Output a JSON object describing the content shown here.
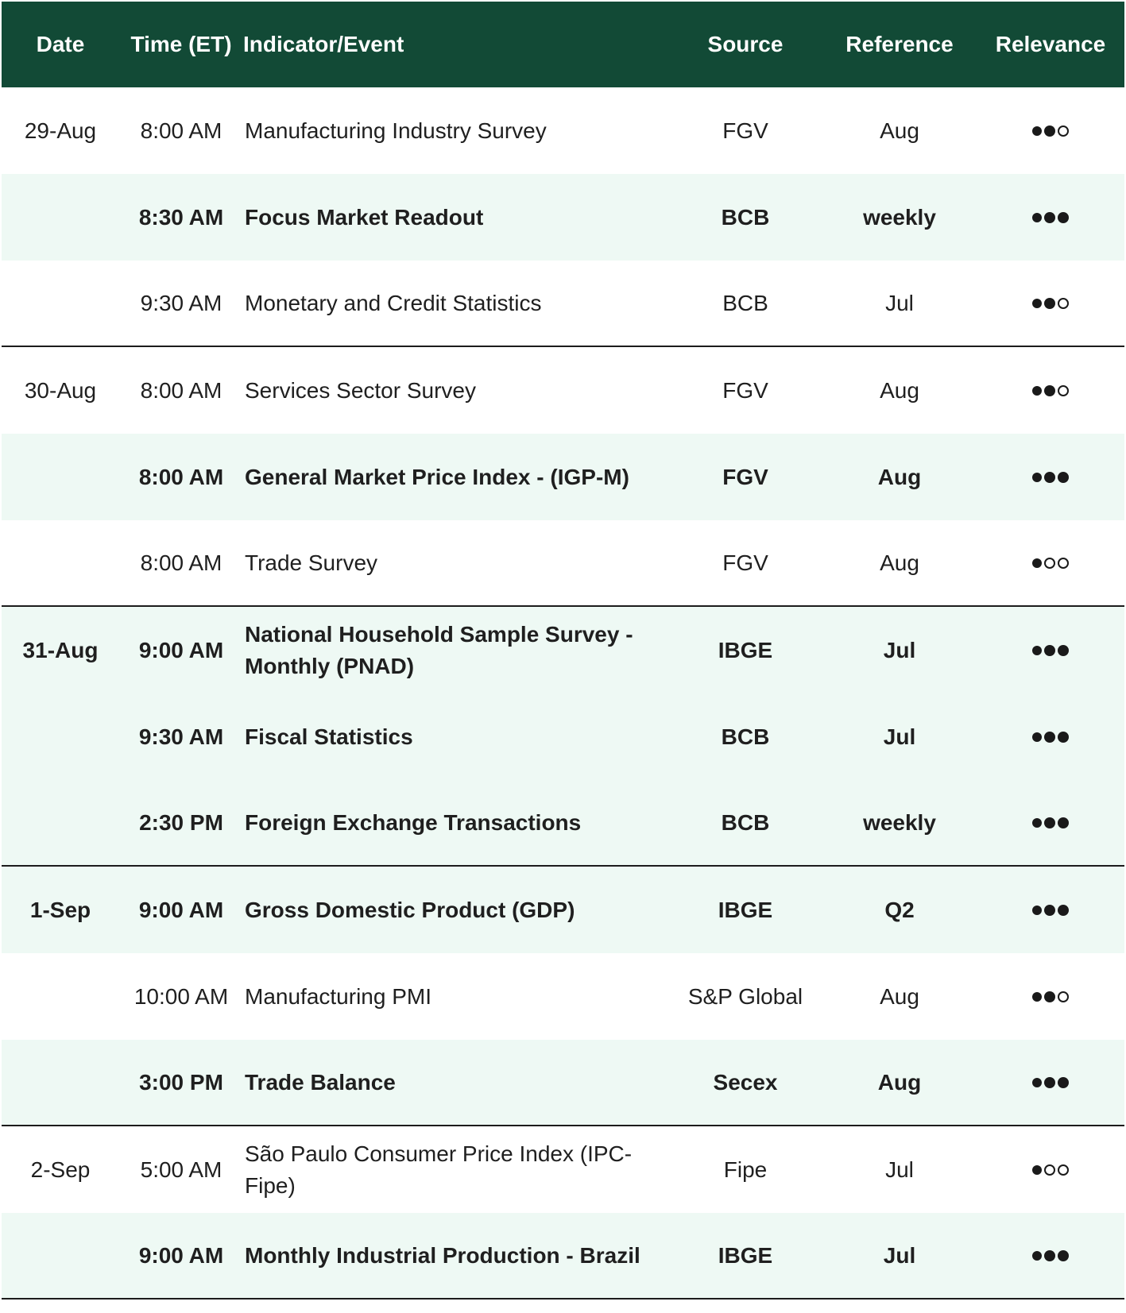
{
  "header": {
    "date": "Date",
    "time": "Time (ET)",
    "event": "Indicator/Event",
    "source": "Source",
    "reference": "Reference",
    "relevance": "Relevance"
  },
  "rows": [
    {
      "date": "29-Aug",
      "time": "8:00 AM",
      "event": "Manufacturing Industry Survey",
      "source": "FGV",
      "reference": "Aug",
      "relevance": 2,
      "bold": false,
      "shade": false,
      "sep": false
    },
    {
      "date": "",
      "time": "8:30 AM",
      "event": "Focus Market Readout",
      "source": "BCB",
      "reference": "weekly",
      "relevance": 3,
      "bold": true,
      "shade": true,
      "sep": false
    },
    {
      "date": "",
      "time": "9:30 AM",
      "event": "Monetary and Credit Statistics",
      "source": "BCB",
      "reference": "Jul",
      "relevance": 2,
      "bold": false,
      "shade": false,
      "sep": true
    },
    {
      "date": "30-Aug",
      "time": "8:00 AM",
      "event": "Services Sector Survey",
      "source": "FGV",
      "reference": "Aug",
      "relevance": 2,
      "bold": false,
      "shade": false,
      "sep": false
    },
    {
      "date": "",
      "time": "8:00 AM",
      "event": "General Market Price Index - (IGP-M)",
      "source": "FGV",
      "reference": "Aug",
      "relevance": 3,
      "bold": true,
      "shade": true,
      "sep": false
    },
    {
      "date": "",
      "time": "8:00 AM",
      "event": "Trade Survey",
      "source": "FGV",
      "reference": "Aug",
      "relevance": 1,
      "bold": false,
      "shade": false,
      "sep": true
    },
    {
      "date": "31-Aug",
      "time": "9:00 AM",
      "event": "National Household Sample Survey - Monthly (PNAD)",
      "source": "IBGE",
      "reference": "Jul",
      "relevance": 3,
      "bold": true,
      "shade": true,
      "sep": false
    },
    {
      "date": "",
      "time": "9:30 AM",
      "event": "Fiscal Statistics",
      "source": "BCB",
      "reference": "Jul",
      "relevance": 3,
      "bold": true,
      "shade": true,
      "sep": false
    },
    {
      "date": "",
      "time": "2:30 PM",
      "event": "Foreign Exchange Transactions",
      "source": "BCB",
      "reference": "weekly",
      "relevance": 3,
      "bold": true,
      "shade": true,
      "sep": true
    },
    {
      "date": "1-Sep",
      "time": "9:00 AM",
      "event": "Gross Domestic Product (GDP)",
      "source": "IBGE",
      "reference": "Q2",
      "relevance": 3,
      "bold": true,
      "shade": true,
      "sep": false
    },
    {
      "date": "",
      "time": "10:00 AM",
      "event": "Manufacturing PMI",
      "source": "S&P Global",
      "reference": "Aug",
      "relevance": 2,
      "bold": false,
      "shade": false,
      "sep": false
    },
    {
      "date": "",
      "time": "3:00 PM",
      "event": "Trade Balance",
      "source": "Secex",
      "reference": "Aug",
      "relevance": 3,
      "bold": true,
      "shade": true,
      "sep": true
    },
    {
      "date": "2-Sep",
      "time": "5:00 AM",
      "event": "São Paulo Consumer Price Index (IPC-Fipe)",
      "source": "Fipe",
      "reference": "Jul",
      "relevance": 1,
      "bold": false,
      "shade": false,
      "sep": false
    },
    {
      "date": "",
      "time": "9:00 AM",
      "event": "Monthly Industrial Production - Brazil",
      "source": "IBGE",
      "reference": "Jul",
      "relevance": 3,
      "bold": true,
      "shade": true,
      "sep": true
    }
  ]
}
